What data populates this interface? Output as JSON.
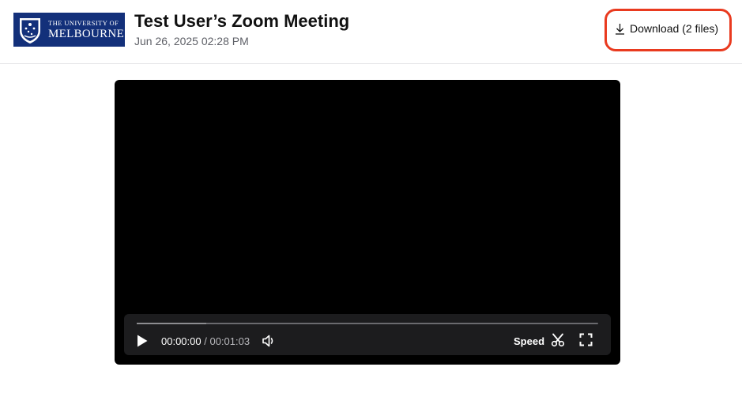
{
  "header": {
    "logo": {
      "line1": "THE UNIVERSITY OF",
      "line2": "MELBOURNE"
    },
    "title": "Test User’s Zoom Meeting",
    "date": "Jun 26, 2025 02:28 PM",
    "download_label": "Download (2 files)"
  },
  "player": {
    "current_time": "00:00:00",
    "separator": "/",
    "total_time": "00:01:03",
    "speed_label": "Speed",
    "progress": 0
  },
  "colors": {
    "logo_bg": "#13307a",
    "highlight": "#e93a1f",
    "control_bar": "#1c1c1e"
  },
  "icons": [
    "download-icon",
    "play-icon",
    "volume-icon",
    "scissors-icon",
    "fullscreen-icon",
    "university-crest-icon"
  ]
}
